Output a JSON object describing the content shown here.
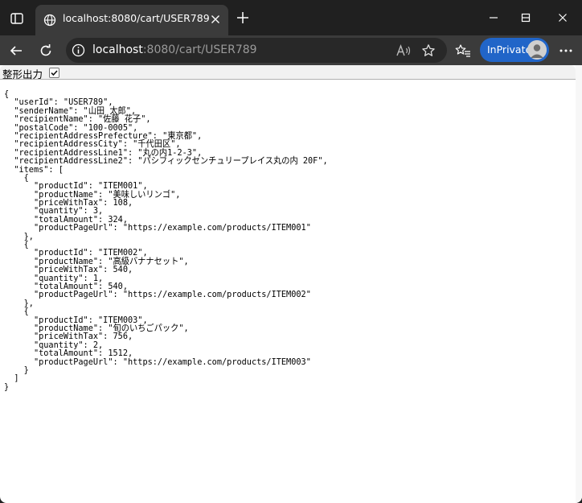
{
  "tab": {
    "title": "localhost:8080/cart/USER789",
    "close_icon": "close-icon",
    "favicon": "globe-icon"
  },
  "address": {
    "host": "localhost",
    "rest": ":8080/cart/USER789"
  },
  "inprivate": {
    "label": "InPrivate"
  },
  "pretty_print": {
    "label": "整形出力",
    "checked": true
  },
  "json_lines": [
    "{",
    "  \"userId\": \"USER789\",",
    "  \"senderName\": \"山田 太郎\",",
    "  \"recipientName\": \"佐藤 花子\",",
    "  \"postalCode\": \"100-0005\",",
    "  \"recipientAddressPrefecture\": \"東京都\",",
    "  \"recipientAddressCity\": \"千代田区\",",
    "  \"recipientAddressLine1\": \"丸の内1-2-3\",",
    "  \"recipientAddressLine2\": \"パシフィックセンチュリープレイス丸の内 20F\",",
    "  \"items\": [",
    "    {",
    "      \"productId\": \"ITEM001\",",
    "      \"productName\": \"美味しいリンゴ\",",
    "      \"priceWithTax\": 108,",
    "      \"quantity\": 3,",
    "      \"totalAmount\": 324,",
    "      \"productPageUrl\": \"https://example.com/products/ITEM001\"",
    "    },",
    "    {",
    "      \"productId\": \"ITEM002\",",
    "      \"productName\": \"高級バナナセット\",",
    "      \"priceWithTax\": 540,",
    "      \"quantity\": 1,",
    "      \"totalAmount\": 540,",
    "      \"productPageUrl\": \"https://example.com/products/ITEM002\"",
    "    },",
    "    {",
    "      \"productId\": \"ITEM003\",",
    "      \"productName\": \"旬のいちごパック\",",
    "      \"priceWithTax\": 756,",
    "      \"quantity\": 2,",
    "      \"totalAmount\": 1512,",
    "      \"productPageUrl\": \"https://example.com/products/ITEM003\"",
    "    }",
    "  ]",
    "}"
  ],
  "colors": {
    "frame": "#202020",
    "toolbar": "#3b3b3b",
    "omnibox": "#282828",
    "inprivate": "#2165c8"
  }
}
